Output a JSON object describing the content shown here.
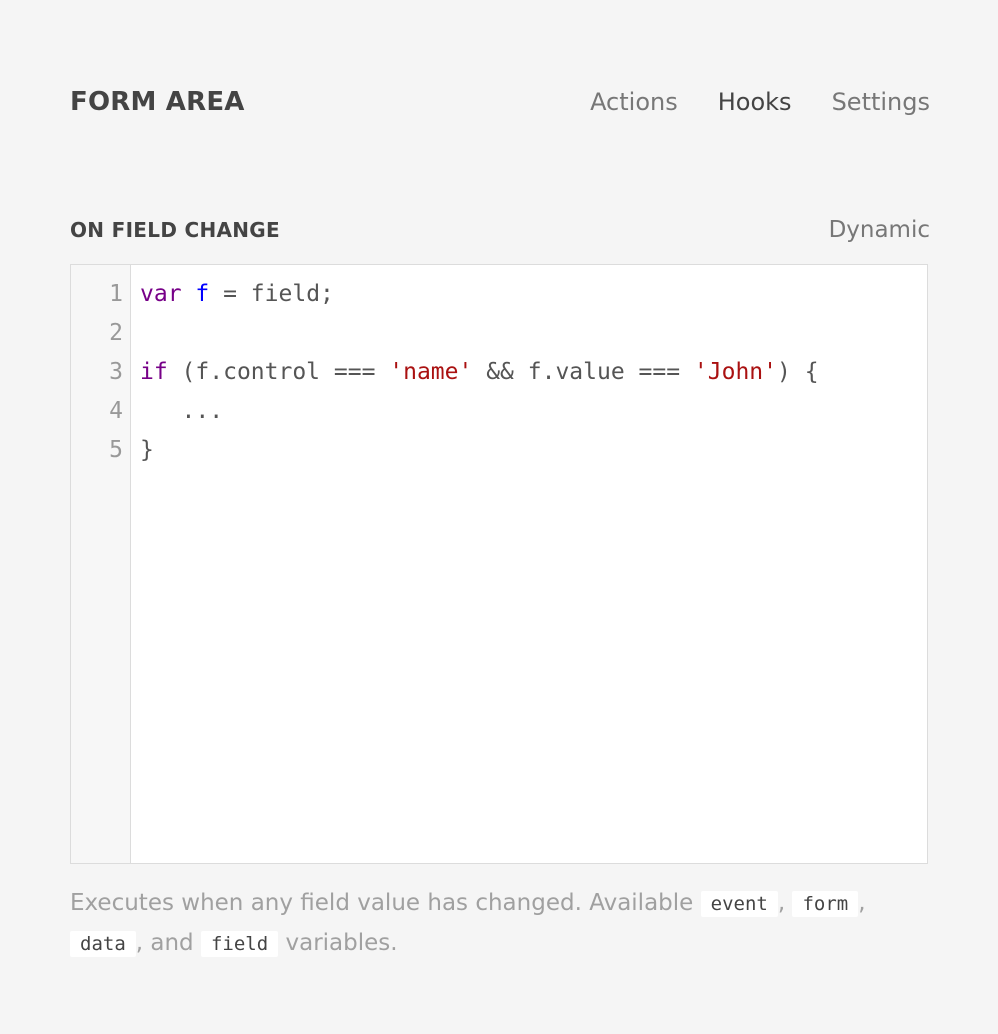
{
  "header": {
    "title": "FORM AREA",
    "nav": [
      {
        "label": "Actions",
        "active": false
      },
      {
        "label": "Hooks",
        "active": true
      },
      {
        "label": "Settings",
        "active": false
      }
    ]
  },
  "section": {
    "title": "ON FIELD CHANGE",
    "mode": "Dynamic"
  },
  "editor": {
    "line_numbers": [
      "1",
      "2",
      "3",
      "4",
      "5"
    ],
    "lines": [
      [
        {
          "t": "var",
          "c": "kw"
        },
        {
          "t": " ",
          "c": ""
        },
        {
          "t": "f",
          "c": "def"
        },
        {
          "t": " = field;",
          "c": ""
        }
      ],
      [],
      [
        {
          "t": "if",
          "c": "kw"
        },
        {
          "t": " (f.control === ",
          "c": ""
        },
        {
          "t": "'name'",
          "c": "str"
        },
        {
          "t": " && f.value === ",
          "c": ""
        },
        {
          "t": "'John'",
          "c": "str"
        },
        {
          "t": ") {",
          "c": ""
        }
      ],
      [
        {
          "t": "   ...",
          "c": ""
        }
      ],
      [
        {
          "t": "}",
          "c": ""
        }
      ]
    ]
  },
  "help": {
    "text_1": "Executes when any field value has changed. Available ",
    "var_1": "event",
    "sep_1": ", ",
    "var_2": "form",
    "sep_2": ", ",
    "var_3": "data",
    "sep_3": ", and ",
    "var_4": "field",
    "text_2": " variables."
  }
}
